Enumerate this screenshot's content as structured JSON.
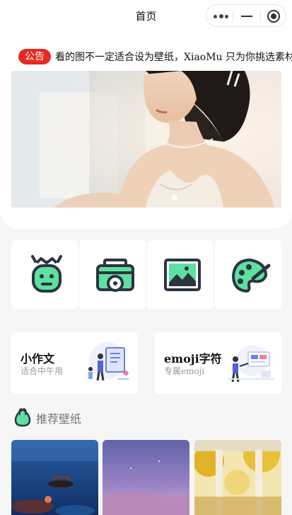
{
  "nav": {
    "title": "首页"
  },
  "notice": {
    "tag": "公告",
    "text": "看的图不一定适合设为壁纸，XiaoMu 只为你挑选素材"
  },
  "banner": {
    "description": "carousel photo of a woman with dark hair in a pale lace dress, soft window light",
    "slide_index": 1
  },
  "tools": [
    {
      "name": "robot-avatar"
    },
    {
      "name": "camera"
    },
    {
      "name": "picture"
    },
    {
      "name": "palette"
    }
  ],
  "features": [
    {
      "title": "小作文",
      "subtitle": "适合中午用"
    },
    {
      "title": "emoji字符",
      "subtitle": "专属emoji"
    }
  ],
  "section": {
    "title": "推荐壁纸"
  },
  "wallpapers": [
    {
      "description": "deep blue ocean scene with people on a raft"
    },
    {
      "description": "purple twilight sky over a shoreline"
    },
    {
      "description": "golden autumn leaves framed by white columns"
    }
  ],
  "colors": {
    "accent": "#5ee0a0",
    "icon_stroke": "#2b3440",
    "notice_red": "#e62a1f"
  }
}
